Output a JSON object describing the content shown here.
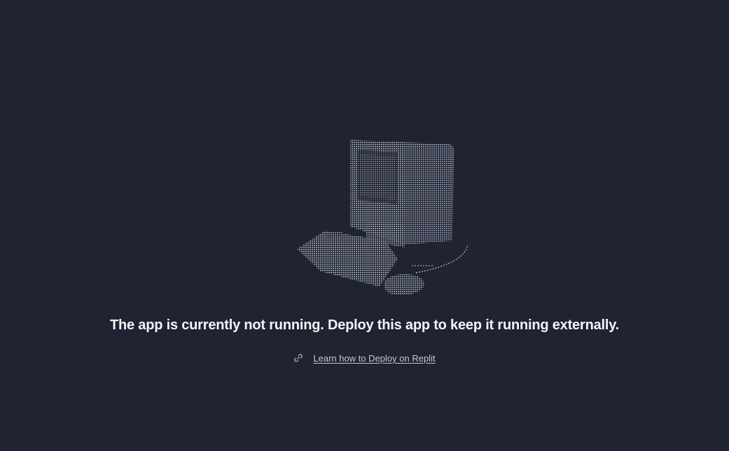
{
  "message": {
    "headline": "The app is currently not running. Deploy this app to keep it running externally."
  },
  "link": {
    "label": "Learn how to Deploy on Replit",
    "icon": "link-icon"
  },
  "illustration": {
    "icon": "ascii-computer-icon"
  },
  "colors": {
    "background": "#1f2332",
    "headline": "#f4f5f8",
    "link": "#c7cbd6",
    "illustration": "#a8aebb"
  }
}
